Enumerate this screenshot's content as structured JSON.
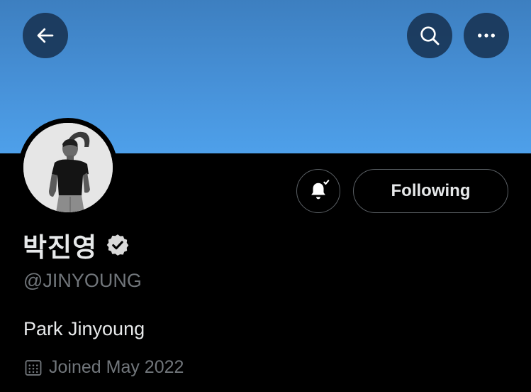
{
  "header": {
    "back_icon": "arrow-left-icon",
    "search_icon": "search-icon",
    "more_icon": "more-horizontal-icon",
    "banner_color": "#4791d8"
  },
  "profile": {
    "display_name": "박진영",
    "verified": true,
    "handle": "@JINYOUNG",
    "bio": "Park Jinyoung",
    "joined": "Joined May 2022",
    "joined_icon": "calendar-icon"
  },
  "actions": {
    "notify_icon": "bell-subscribed-icon",
    "following_label": "Following"
  }
}
